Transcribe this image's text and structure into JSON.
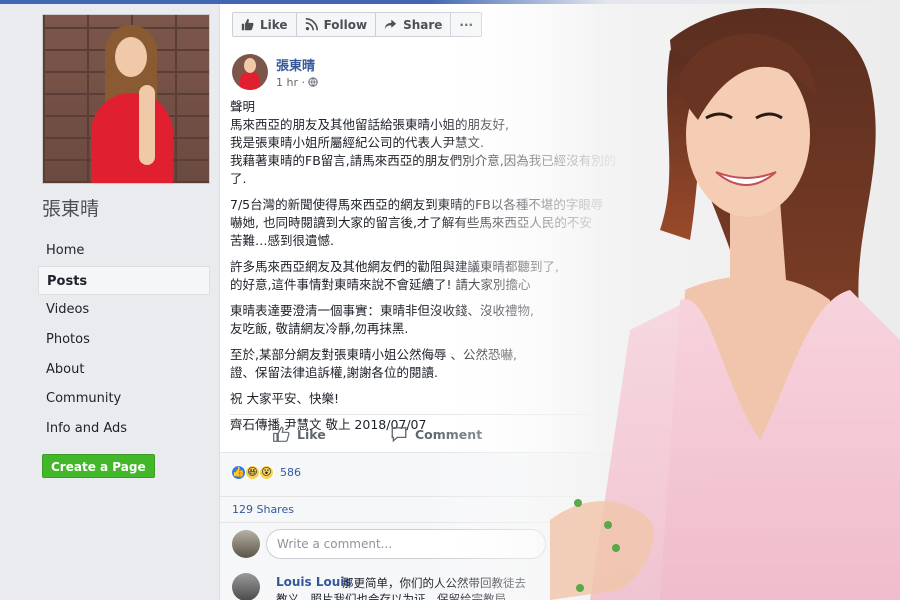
{
  "page": {
    "name": "張東晴"
  },
  "nav": {
    "items": [
      "Home",
      "Posts",
      "Videos",
      "Photos",
      "About",
      "Community",
      "Info and Ads"
    ],
    "active": "Posts",
    "create_button": "Create a Page"
  },
  "actionbar": {
    "like": "Like",
    "follow": "Follow",
    "share": "Share",
    "more": "···"
  },
  "post": {
    "author": "張東晴",
    "time": "1 hr ·",
    "paragraphs": [
      [
        "聲明",
        "馬來西亞的朋友及其他留話給張東晴小姐的朋友好,",
        "我是張東晴小姐所屬經紀公司的代表人尹慧文.",
        "我藉著東晴的FB留言,請馬來西亞的朋友們別介意,因為我已經沒有別的",
        "了."
      ],
      [
        "7/5台灣的新聞使得馬來西亞的網友到東晴的FB以各種不堪的字眼辱",
        "嚇她, 也同時閱讀到大家的留言後,才了解有些馬來西亞人民的不安",
        "苦難…感到很遺憾."
      ],
      [
        "許多馬來西亞網友及其他網友們的勸阻與建議東晴都聽到了,",
        "的好意,這件事情對東晴來說不會延續了! 請大家別擔心"
      ],
      [
        "東晴表達要澄清一個事實：東晴非但沒收錢、沒收禮物,",
        "友吃飯, 敬請網友冷靜,勿再抹黑."
      ],
      [
        "至於,某部分網友對張東晴小姐公然侮辱 、公然恐嚇,",
        "證、保留法律追訴權,謝謝各位的閱讀."
      ],
      [
        "祝 大家平安、快樂!"
      ],
      [
        "齊石傳播 尹慧文 敬上 2018/07/07"
      ]
    ],
    "like_label": "Like",
    "comment_label": "Comment",
    "reaction_count": "586",
    "shares": "129 Shares",
    "comment_placeholder": "Write a comment...",
    "comment": {
      "author": "Louis Louis",
      "line1": "那更简单，你们的人公然带回教徒去",
      "line2": "教义，照片我们也会存以为证，保留给宗教局"
    }
  }
}
